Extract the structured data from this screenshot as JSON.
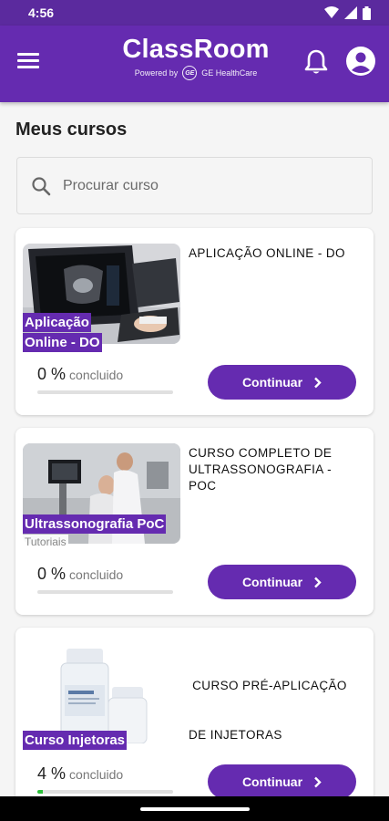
{
  "status_bar": {
    "time": "4:56",
    "icons": [
      "wifi-icon",
      "signal-icon",
      "battery-icon"
    ]
  },
  "app_bar": {
    "title": "ClassRoom",
    "powered_by": "Powered by",
    "partner": "GE HealthCare",
    "partner_logo": "GE"
  },
  "page": {
    "title": "Meus cursos"
  },
  "search": {
    "placeholder": "Procurar curso",
    "value": ""
  },
  "courses": [
    {
      "thumbnail_label_lines": [
        "Aplicação",
        "Online - DO"
      ],
      "thumbnail_tag": "",
      "title_lines": [
        "APLICAÇÃO ONLINE - DO"
      ],
      "progress_value": "0",
      "progress_unit": "%",
      "progress_label": "concluido",
      "progress_fraction": 0.0,
      "button_label": "Continuar"
    },
    {
      "thumbnail_label_lines": [
        "Ultrassonografia PoC"
      ],
      "thumbnail_tag": "Tutoriais",
      "title_lines": [
        "CURSO COMPLETO DE",
        "ULTRASSONOGRAFIA -",
        "POC"
      ],
      "progress_value": "0",
      "progress_unit": "%",
      "progress_label": "concluido",
      "progress_fraction": 0.0,
      "button_label": "Continuar"
    },
    {
      "thumbnail_label_lines": [
        "Curso Injetoras"
      ],
      "thumbnail_tag": "",
      "title_lines": [
        " CURSO PRÉ-APLICAÇÃO",
        "DE INJETORAS"
      ],
      "progress_value": "4",
      "progress_unit": "%",
      "progress_label": "concluido",
      "progress_fraction": 0.04,
      "button_label": "Continuar"
    }
  ],
  "colors": {
    "primary": "#652bb0",
    "status_bar": "#5b2a9e",
    "progress_fill": "#2bbf3a"
  }
}
